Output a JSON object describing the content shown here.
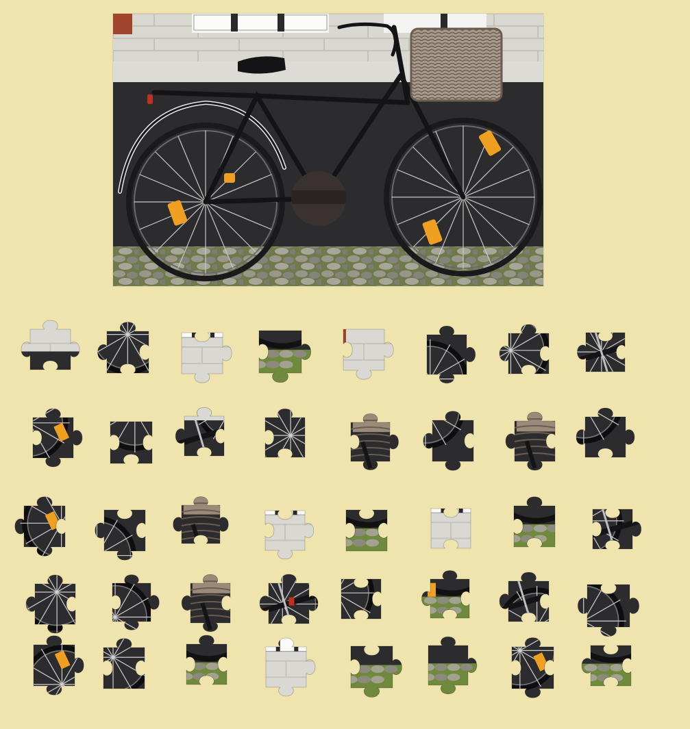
{
  "puzzle": {
    "image_subject": "black-bicycle-with-wicker-basket",
    "rows": 5,
    "cols": 8,
    "piece_count": 40,
    "colors": {
      "background": "#f0e4ae",
      "wall_upper": "#d9d8d2",
      "wall_lower": "#2c2c2e",
      "brick": "#a0442e",
      "cobble": "#8b8a7c",
      "moss": "#6f8a3c",
      "bike_black": "#141416",
      "basket": "#9a8a7a",
      "reflector": "#f0a020",
      "spoke": "#d0d0d0"
    }
  },
  "pieces": [
    {
      "id": 1,
      "region": "wall-upper-left"
    },
    {
      "id": 2,
      "region": "rear-wheel-spokes"
    },
    {
      "id": 3,
      "region": "window-bars"
    },
    {
      "id": 4,
      "region": "wheel-cobbles"
    },
    {
      "id": 5,
      "region": "brick-corner"
    },
    {
      "id": 6,
      "region": "rear-wheel-spokes"
    },
    {
      "id": 7,
      "region": "front-wheel-spokes"
    },
    {
      "id": 8,
      "region": "saddle-frame"
    },
    {
      "id": 9,
      "region": "rear-wheel-reflector"
    },
    {
      "id": 10,
      "region": "wall-dark-band"
    },
    {
      "id": 11,
      "region": "handlebar"
    },
    {
      "id": 12,
      "region": "rear-wheel-spokes"
    },
    {
      "id": 13,
      "region": "handlebar-basket"
    },
    {
      "id": 14,
      "region": "wall-dark-band"
    },
    {
      "id": 15,
      "region": "wicker-basket"
    },
    {
      "id": 16,
      "region": "wall-dark-band"
    },
    {
      "id": 17,
      "region": "front-wheel-reflector"
    },
    {
      "id": 18,
      "region": "rear-wheel-spokes"
    },
    {
      "id": 19,
      "region": "wall-basket-edge"
    },
    {
      "id": 20,
      "region": "window-bars"
    },
    {
      "id": 21,
      "region": "wheel-cobbles"
    },
    {
      "id": 22,
      "region": "window-basket"
    },
    {
      "id": 23,
      "region": "cobble-tyre"
    },
    {
      "id": 24,
      "region": "pedal-crank"
    },
    {
      "id": 25,
      "region": "front-wheel-spokes"
    },
    {
      "id": 26,
      "region": "rear-wheel-spokes"
    },
    {
      "id": 27,
      "region": "basket-fork"
    },
    {
      "id": 28,
      "region": "wall-rear-light"
    },
    {
      "id": 29,
      "region": "front-tyre"
    },
    {
      "id": 30,
      "region": "reflector-cobbles"
    },
    {
      "id": 31,
      "region": "chain-guard"
    },
    {
      "id": 32,
      "region": "front-wheel-spokes"
    },
    {
      "id": 33,
      "region": "rear-wheel-reflector"
    },
    {
      "id": 34,
      "region": "rear-wheel-spokes"
    },
    {
      "id": 35,
      "region": "cobble-tyre"
    },
    {
      "id": 36,
      "region": "window-bars"
    },
    {
      "id": 37,
      "region": "cobblestones"
    },
    {
      "id": 38,
      "region": "cobblestones"
    },
    {
      "id": 39,
      "region": "front-wheel-reflector"
    },
    {
      "id": 40,
      "region": "front-tyre-cobbles"
    }
  ]
}
